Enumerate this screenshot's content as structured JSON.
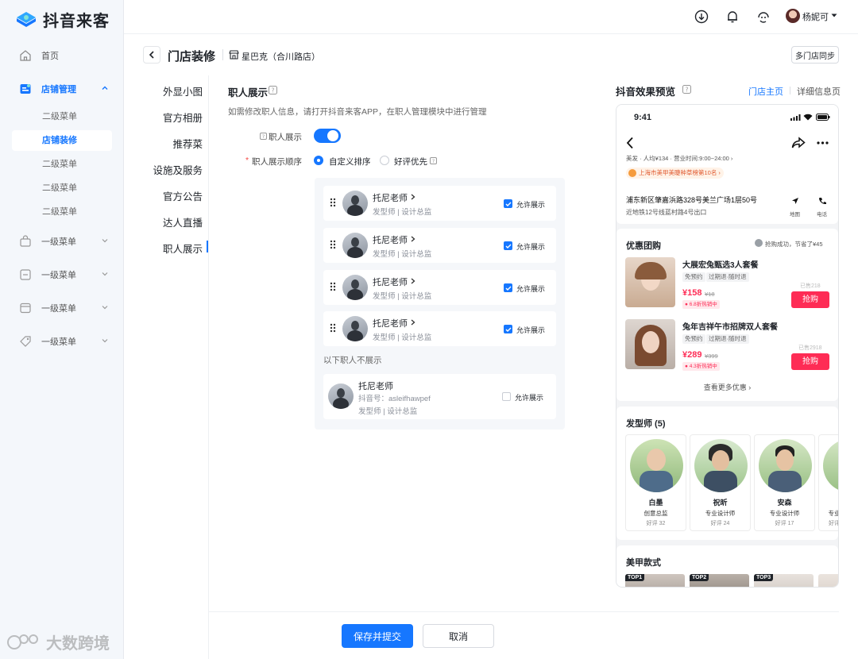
{
  "app": {
    "name": "抖音来客"
  },
  "sidebar": {
    "home": "首页",
    "store_mgmt": "店铺管理",
    "sub_items": [
      "二级菜单",
      "店铺装修",
      "二级菜单",
      "二级菜单",
      "二级菜单"
    ],
    "level1_items": [
      "一级菜单",
      "一级菜单",
      "一级菜单",
      "一级菜单"
    ]
  },
  "topbar": {
    "user_name": "杨妮可"
  },
  "page": {
    "title": "门店装修",
    "store_name": "星巴克（合川路店）",
    "sync_button": "多门店同步"
  },
  "tabs": [
    "外显小图",
    "官方相册",
    "推荐菜",
    "设施及服务",
    "官方公告",
    "达人直播",
    "职人展示"
  ],
  "section": {
    "title": "职人展示",
    "hint": "如需修改职人信息，请打开抖音来客APP，在职人管理模块中进行管理",
    "toggle_label": "职人展示",
    "order_label": "职人展示顺序",
    "order_options": [
      "自定义排序",
      "好评优先"
    ],
    "employees": [
      {
        "name": "托尼老师",
        "desc": "发型师 | 设计总监",
        "allow": "允许展示"
      },
      {
        "name": "托尼老师",
        "desc": "发型师 | 设计总监",
        "allow": "允许展示"
      },
      {
        "name": "托尼老师",
        "desc": "发型师 | 设计总监",
        "allow": "允许展示"
      },
      {
        "name": "托尼老师",
        "desc": "发型师 | 设计总监",
        "allow": "允许展示"
      }
    ],
    "hidden_label": "以下职人不展示",
    "hidden_employee": {
      "name": "托尼老师",
      "douyin_id": "抖音号：asleifhawpef",
      "desc": "发型师 | 设计总监",
      "allow": "允许展示"
    }
  },
  "preview": {
    "title": "抖音效果预览",
    "tab_store": "门店主页",
    "tab_detail": "详细信息页",
    "phone": {
      "time": "9:41",
      "info_line": "美发 · 人均¥134 · 营业时间:9:00~24:00 ›",
      "rank_badge": "上海市美甲美睫种草榜第10名 ›",
      "address": "浦东新区肇嘉浜路328号美兰广场1层50号",
      "subway": "近地铁12号线蓝村路4号出口",
      "map_label": "地图",
      "phone_label": "电话",
      "deals_title": "优惠团购",
      "deals_note": "抢购成功，节省了¥45",
      "deals": [
        {
          "name": "大展宏兔甄选3人套餐",
          "tags": [
            "免预约",
            "过期退·随时退"
          ],
          "price": "¥158",
          "orig": "¥18",
          "discount": "6.8折热销中",
          "sold": "已售218",
          "buy": "抢购"
        },
        {
          "name": "兔年吉祥午市招牌双人套餐",
          "tags": [
            "免预约",
            "过期退·随时退"
          ],
          "price": "¥289",
          "orig": "¥399",
          "discount": "4.3折热销中",
          "sold": "已售2918",
          "buy": "抢购"
        }
      ],
      "more_deals": "查看更多优惠 ›",
      "stylists_title": "发型师 (5)",
      "stylists": [
        {
          "name": "白墨",
          "title": "创意总监",
          "rating": "好评 32"
        },
        {
          "name": "祝昕",
          "title": "专业设计师",
          "rating": "好评 24"
        },
        {
          "name": "安森",
          "title": "专业设计师",
          "rating": "好评 17"
        },
        {
          "name": "",
          "title": "专业",
          "rating": "好评"
        }
      ],
      "nail_title": "美甲款式",
      "top_badges": [
        "TOP1",
        "TOP2",
        "TOP3"
      ]
    }
  },
  "footer": {
    "save": "保存并提交",
    "cancel": "取消"
  },
  "watermark": "大数跨境",
  "colors": {
    "primary": "#1677ff",
    "douyin_red": "#fe2c55"
  }
}
